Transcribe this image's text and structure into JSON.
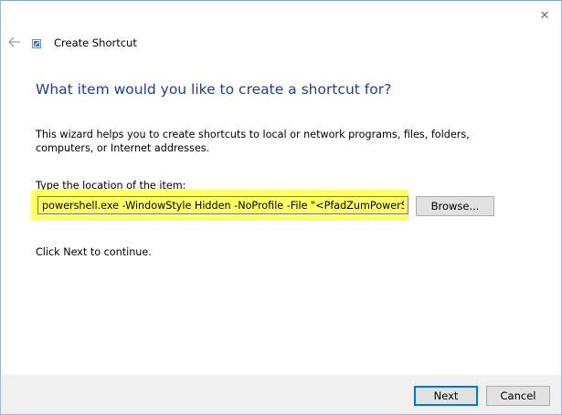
{
  "window": {
    "title": "Create Shortcut",
    "close_glyph": "✕",
    "back_glyph": "←"
  },
  "wizard": {
    "heading": "What item would you like to create a shortcut for?",
    "description": "This wizard helps you to create shortcuts to local or network programs, files, folders, computers, or Internet addresses.",
    "location_label": "Type the location of the item:",
    "location_value": "powershell.exe -WindowStyle Hidden -NoProfile -File \"<PfadZumPowerShellScript>\"",
    "continue_text": "Click Next to continue."
  },
  "buttons": {
    "browse_label": "Browse...",
    "next_label": "Next",
    "cancel_label": "Cancel"
  },
  "colors": {
    "heading": "#1f3d9a",
    "highlight": "#ffff66",
    "accent": "#0078d7"
  },
  "icons": {
    "back": "back-arrow-icon",
    "title": "shortcut-icon",
    "close": "close-icon"
  }
}
